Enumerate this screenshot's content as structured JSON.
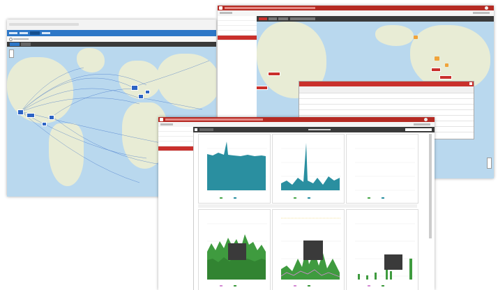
{
  "windows": {
    "left_title": "",
    "right_title": "",
    "front_title": ""
  },
  "left_window": {
    "tabs": [
      "",
      "",
      ""
    ]
  },
  "right_window": {
    "sidebar": [
      "",
      "",
      "",
      "",
      ""
    ]
  },
  "front_window": {
    "sidebar": [
      "",
      "",
      "",
      "",
      ""
    ]
  },
  "colors": {
    "brand": "#b52a23",
    "chart_teal": "#2a8fa0",
    "chart_green": "#3f9b3f",
    "map_water": "#b9d8ee"
  }
}
